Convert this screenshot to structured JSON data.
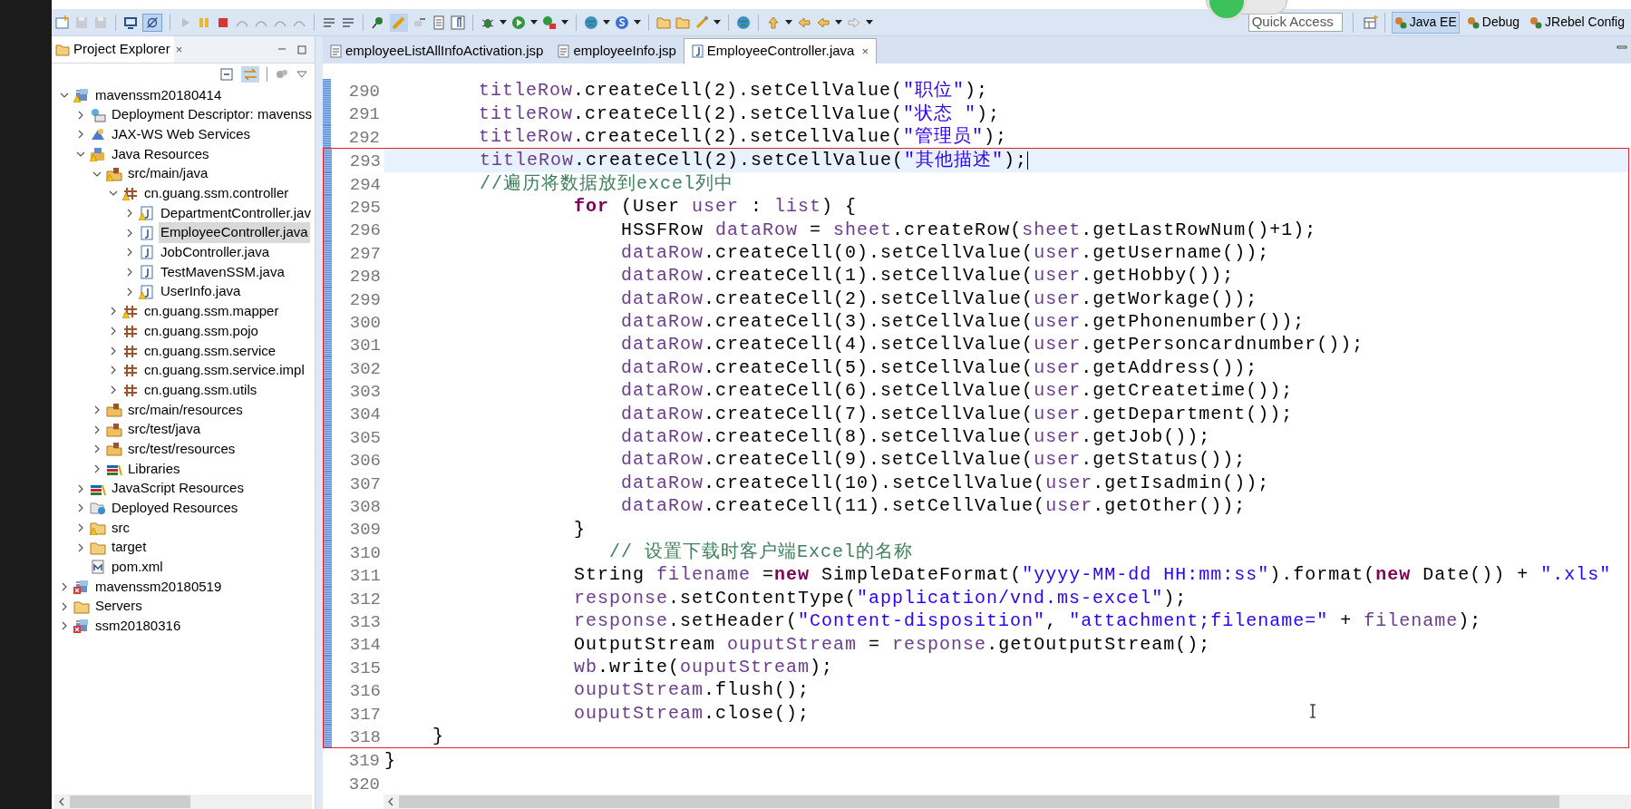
{
  "toolbar": {
    "quick_access": {
      "placeholder": "Quick Access"
    },
    "perspectives": [
      {
        "label": "Java EE",
        "selected": true
      },
      {
        "label": "Debug",
        "selected": false
      },
      {
        "label": "JRebel Config",
        "selected": false
      }
    ]
  },
  "explorer": {
    "tab": {
      "label": "Project Explorer",
      "close": "×"
    },
    "tree": [
      {
        "label": "mavenssm20180414",
        "kind": "project",
        "warning": true,
        "expanded": true,
        "selected": false,
        "children": [
          {
            "label": "Deployment Descriptor: mavenss",
            "kind": "descriptor",
            "expanded": false,
            "selected": false
          },
          {
            "label": "JAX-WS Web Services",
            "kind": "webservice",
            "expanded": false,
            "selected": false
          },
          {
            "label": "Java Resources",
            "kind": "java-resources",
            "warning": true,
            "expanded": true,
            "selected": false,
            "children": [
              {
                "label": "src/main/java",
                "kind": "source-folder",
                "warning": true,
                "expanded": true,
                "selected": false,
                "children": [
                  {
                    "label": "cn.guang.ssm.controller",
                    "kind": "package",
                    "warning": true,
                    "expanded": true,
                    "selected": false,
                    "children": [
                      {
                        "label": "DepartmentController.jav",
                        "kind": "java-file",
                        "warning": true,
                        "expanded": false,
                        "selected": false
                      },
                      {
                        "label": "EmployeeController.java",
                        "kind": "java-file",
                        "expanded": false,
                        "selected": true
                      },
                      {
                        "label": "JobController.java",
                        "kind": "java-file",
                        "expanded": false,
                        "selected": false
                      },
                      {
                        "label": "TestMavenSSM.java",
                        "kind": "java-file",
                        "expanded": false,
                        "selected": false
                      },
                      {
                        "label": "UserInfo.java",
                        "kind": "java-file",
                        "warning": true,
                        "expanded": false,
                        "selected": false
                      }
                    ]
                  },
                  {
                    "label": "cn.guang.ssm.mapper",
                    "kind": "package",
                    "warning": true,
                    "expanded": false,
                    "selected": false
                  },
                  {
                    "label": "cn.guang.ssm.pojo",
                    "kind": "package",
                    "expanded": false,
                    "selected": false
                  },
                  {
                    "label": "cn.guang.ssm.service",
                    "kind": "package",
                    "expanded": false,
                    "selected": false
                  },
                  {
                    "label": "cn.guang.ssm.service.impl",
                    "kind": "package",
                    "expanded": false,
                    "selected": false
                  },
                  {
                    "label": "cn.guang.ssm.utils",
                    "kind": "package",
                    "expanded": false,
                    "selected": false
                  }
                ]
              },
              {
                "label": "src/main/resources",
                "kind": "source-folder",
                "expanded": false,
                "selected": false
              },
              {
                "label": "src/test/java",
                "kind": "source-folder",
                "expanded": false,
                "selected": false
              },
              {
                "label": "src/test/resources",
                "kind": "source-folder",
                "expanded": false,
                "selected": false
              },
              {
                "label": "Libraries",
                "kind": "libraries",
                "expanded": false,
                "selected": false
              }
            ]
          },
          {
            "label": "JavaScript Resources",
            "kind": "libraries",
            "expanded": false,
            "selected": false
          },
          {
            "label": "Deployed Resources",
            "kind": "deployed",
            "expanded": false,
            "selected": false
          },
          {
            "label": "src",
            "kind": "folder",
            "warning": true,
            "expanded": false,
            "selected": false
          },
          {
            "label": "target",
            "kind": "folder",
            "expanded": false,
            "selected": false
          },
          {
            "label": "pom.xml",
            "kind": "xml-file",
            "selected": false
          }
        ]
      },
      {
        "label": "mavenssm20180519",
        "kind": "project",
        "error": true,
        "expanded": false,
        "selected": false
      },
      {
        "label": "Servers",
        "kind": "folder",
        "expanded": false,
        "selected": false
      },
      {
        "label": "ssm20180316",
        "kind": "project",
        "error": true,
        "expanded": false,
        "selected": false
      }
    ]
  },
  "editor": {
    "tabs": [
      {
        "label": "employeeListAllInfoActivation.jsp",
        "kind": "jsp",
        "selected": false
      },
      {
        "label": "employeeInfo.jsp",
        "kind": "jsp",
        "selected": false
      },
      {
        "label": "EmployeeController.java",
        "kind": "java",
        "selected": true,
        "close": "×"
      }
    ],
    "lines_before": [
      {
        "number": "290",
        "changed": true,
        "current": false,
        "tokens": [
          {
            "kind": "local",
            "text": "        titleRow"
          },
          {
            "kind": "plain",
            "text": ".createCell(2).setCellValue("
          },
          {
            "kind": "string",
            "text": "\"职位\""
          },
          {
            "kind": "plain",
            "text": ");"
          }
        ]
      },
      {
        "number": "291",
        "changed": true,
        "current": false,
        "tokens": [
          {
            "kind": "local",
            "text": "        titleRow"
          },
          {
            "kind": "plain",
            "text": ".createCell(2).setCellValue("
          },
          {
            "kind": "string",
            "text": "\"状态 \""
          },
          {
            "kind": "plain",
            "text": ");"
          }
        ]
      },
      {
        "number": "292",
        "changed": true,
        "current": false,
        "tokens": [
          {
            "kind": "local",
            "text": "        titleRow"
          },
          {
            "kind": "plain",
            "text": ".createCell(2).setCellValue("
          },
          {
            "kind": "string",
            "text": "\"管理员\""
          },
          {
            "kind": "plain",
            "text": ");"
          }
        ]
      }
    ],
    "lines_boxed": [
      {
        "number": "293",
        "changed": true,
        "current": true,
        "tokens": [
          {
            "kind": "local",
            "text": "        titleRow"
          },
          {
            "kind": "plain",
            "text": ".createCell(2).setCellValue("
          },
          {
            "kind": "string",
            "text": "\"其他描述\""
          },
          {
            "kind": "plain",
            "text": ");"
          }
        ]
      },
      {
        "number": "294",
        "changed": true,
        "current": false,
        "tokens": [
          {
            "kind": "comment",
            "text": "        //遍历将数据放到excel列中"
          }
        ]
      },
      {
        "number": "295",
        "changed": true,
        "current": false,
        "tokens": [
          {
            "kind": "keyword",
            "text": "                for"
          },
          {
            "kind": "plain",
            "text": " (User "
          },
          {
            "kind": "local",
            "text": "user"
          },
          {
            "kind": "plain",
            "text": " : "
          },
          {
            "kind": "local",
            "text": "list"
          },
          {
            "kind": "plain",
            "text": ") {"
          }
        ]
      },
      {
        "number": "296",
        "changed": true,
        "current": false,
        "tokens": [
          {
            "kind": "plain",
            "text": "                    HSSFRow "
          },
          {
            "kind": "local",
            "text": "dataRow"
          },
          {
            "kind": "plain",
            "text": " = "
          },
          {
            "kind": "local",
            "text": "sheet"
          },
          {
            "kind": "plain",
            "text": ".createRow("
          },
          {
            "kind": "local",
            "text": "sheet"
          },
          {
            "kind": "plain",
            "text": ".getLastRowNum()+1);"
          }
        ]
      },
      {
        "number": "297",
        "changed": true,
        "current": false,
        "tokens": [
          {
            "kind": "local",
            "text": "                    dataRow"
          },
          {
            "kind": "plain",
            "text": ".createCell(0).setCellValue("
          },
          {
            "kind": "local",
            "text": "user"
          },
          {
            "kind": "plain",
            "text": ".getUsername());"
          }
        ]
      },
      {
        "number": "298",
        "changed": true,
        "current": false,
        "tokens": [
          {
            "kind": "local",
            "text": "                    dataRow"
          },
          {
            "kind": "plain",
            "text": ".createCell(1).setCellValue("
          },
          {
            "kind": "local",
            "text": "user"
          },
          {
            "kind": "plain",
            "text": ".getHobby());"
          }
        ]
      },
      {
        "number": "299",
        "changed": true,
        "current": false,
        "tokens": [
          {
            "kind": "local",
            "text": "                    dataRow"
          },
          {
            "kind": "plain",
            "text": ".createCell(2).setCellValue("
          },
          {
            "kind": "local",
            "text": "user"
          },
          {
            "kind": "plain",
            "text": ".getWorkage());"
          }
        ]
      },
      {
        "number": "300",
        "changed": true,
        "current": false,
        "tokens": [
          {
            "kind": "local",
            "text": "                    dataRow"
          },
          {
            "kind": "plain",
            "text": ".createCell(3).setCellValue("
          },
          {
            "kind": "local",
            "text": "user"
          },
          {
            "kind": "plain",
            "text": ".getPhonenumber());"
          }
        ]
      },
      {
        "number": "301",
        "changed": true,
        "current": false,
        "tokens": [
          {
            "kind": "local",
            "text": "                    dataRow"
          },
          {
            "kind": "plain",
            "text": ".createCell(4).setCellValue("
          },
          {
            "kind": "local",
            "text": "user"
          },
          {
            "kind": "plain",
            "text": ".getPersoncardnumber());"
          }
        ]
      },
      {
        "number": "302",
        "changed": true,
        "current": false,
        "tokens": [
          {
            "kind": "local",
            "text": "                    dataRow"
          },
          {
            "kind": "plain",
            "text": ".createCell(5).setCellValue("
          },
          {
            "kind": "local",
            "text": "user"
          },
          {
            "kind": "plain",
            "text": ".getAddress());"
          }
        ]
      },
      {
        "number": "303",
        "changed": true,
        "current": false,
        "tokens": [
          {
            "kind": "local",
            "text": "                    dataRow"
          },
          {
            "kind": "plain",
            "text": ".createCell(6).setCellValue("
          },
          {
            "kind": "local",
            "text": "user"
          },
          {
            "kind": "plain",
            "text": ".getCreatetime());"
          }
        ]
      },
      {
        "number": "304",
        "changed": true,
        "current": false,
        "tokens": [
          {
            "kind": "local",
            "text": "                    dataRow"
          },
          {
            "kind": "plain",
            "text": ".createCell(7).setCellValue("
          },
          {
            "kind": "local",
            "text": "user"
          },
          {
            "kind": "plain",
            "text": ".getDepartment());"
          }
        ]
      },
      {
        "number": "305",
        "changed": true,
        "current": false,
        "tokens": [
          {
            "kind": "local",
            "text": "                    dataRow"
          },
          {
            "kind": "plain",
            "text": ".createCell(8).setCellValue("
          },
          {
            "kind": "local",
            "text": "user"
          },
          {
            "kind": "plain",
            "text": ".getJob());"
          }
        ]
      },
      {
        "number": "306",
        "changed": true,
        "current": false,
        "tokens": [
          {
            "kind": "local",
            "text": "                    dataRow"
          },
          {
            "kind": "plain",
            "text": ".createCell(9).setCellValue("
          },
          {
            "kind": "local",
            "text": "user"
          },
          {
            "kind": "plain",
            "text": ".getStatus());"
          }
        ]
      },
      {
        "number": "307",
        "changed": true,
        "current": false,
        "tokens": [
          {
            "kind": "local",
            "text": "                    dataRow"
          },
          {
            "kind": "plain",
            "text": ".createCell(10).setCellValue("
          },
          {
            "kind": "local",
            "text": "user"
          },
          {
            "kind": "plain",
            "text": ".getIsadmin());"
          }
        ]
      },
      {
        "number": "308",
        "changed": true,
        "current": false,
        "tokens": [
          {
            "kind": "local",
            "text": "                    dataRow"
          },
          {
            "kind": "plain",
            "text": ".createCell(11).setCellValue("
          },
          {
            "kind": "local",
            "text": "user"
          },
          {
            "kind": "plain",
            "text": ".getOther());"
          }
        ]
      },
      {
        "number": "309",
        "changed": true,
        "current": false,
        "tokens": [
          {
            "kind": "plain",
            "text": "                }"
          }
        ]
      },
      {
        "number": "310",
        "changed": true,
        "current": false,
        "tokens": [
          {
            "kind": "comment",
            "text": "                   // 设置下载时客户端Excel的名称"
          }
        ]
      },
      {
        "number": "311",
        "changed": true,
        "current": false,
        "tokens": [
          {
            "kind": "plain",
            "text": "                String "
          },
          {
            "kind": "local",
            "text": "filename"
          },
          {
            "kind": "plain",
            "text": " ="
          },
          {
            "kind": "keyword",
            "text": "new"
          },
          {
            "kind": "plain",
            "text": " SimpleDateFormat("
          },
          {
            "kind": "string",
            "text": "\"yyyy-MM-dd HH:mm:ss\""
          },
          {
            "kind": "plain",
            "text": ").format("
          },
          {
            "kind": "keyword",
            "text": "new"
          },
          {
            "kind": "plain",
            "text": " Date()) + "
          },
          {
            "kind": "string",
            "text": "\".xls\""
          }
        ]
      },
      {
        "number": "312",
        "changed": true,
        "current": false,
        "tokens": [
          {
            "kind": "local",
            "text": "                response"
          },
          {
            "kind": "plain",
            "text": ".setContentType("
          },
          {
            "kind": "string",
            "text": "\"application/vnd.ms-excel\""
          },
          {
            "kind": "plain",
            "text": ");"
          }
        ]
      },
      {
        "number": "313",
        "changed": true,
        "current": false,
        "tokens": [
          {
            "kind": "local",
            "text": "                response"
          },
          {
            "kind": "plain",
            "text": ".setHeader("
          },
          {
            "kind": "string",
            "text": "\"Content-disposition\""
          },
          {
            "kind": "plain",
            "text": ", "
          },
          {
            "kind": "string",
            "text": "\"attachment;filename=\""
          },
          {
            "kind": "plain",
            "text": " + "
          },
          {
            "kind": "local",
            "text": "filename"
          },
          {
            "kind": "plain",
            "text": ");"
          }
        ]
      },
      {
        "number": "314",
        "changed": true,
        "current": false,
        "tokens": [
          {
            "kind": "plain",
            "text": "                OutputStream "
          },
          {
            "kind": "local",
            "text": "ouputStream"
          },
          {
            "kind": "plain",
            "text": " = "
          },
          {
            "kind": "local",
            "text": "response"
          },
          {
            "kind": "plain",
            "text": ".getOutputStream();"
          }
        ]
      },
      {
        "number": "315",
        "changed": true,
        "current": false,
        "tokens": [
          {
            "kind": "local",
            "text": "                wb"
          },
          {
            "kind": "plain",
            "text": ".write("
          },
          {
            "kind": "local",
            "text": "ouputStream"
          },
          {
            "kind": "plain",
            "text": ");"
          }
        ]
      },
      {
        "number": "316",
        "changed": true,
        "current": false,
        "tokens": [
          {
            "kind": "local",
            "text": "                ouputStream"
          },
          {
            "kind": "plain",
            "text": ".flush();"
          }
        ]
      },
      {
        "number": "317",
        "changed": true,
        "current": false,
        "tokens": [
          {
            "kind": "local",
            "text": "                ouputStream"
          },
          {
            "kind": "plain",
            "text": ".close();"
          }
        ]
      },
      {
        "number": "318",
        "changed": true,
        "current": false,
        "tokens": [
          {
            "kind": "plain",
            "text": "    }"
          }
        ]
      }
    ],
    "lines_after": [
      {
        "number": "319",
        "changed": false,
        "current": false,
        "tokens": [
          {
            "kind": "plain",
            "text": "}"
          }
        ]
      },
      {
        "number": "320",
        "changed": false,
        "current": false
      }
    ]
  }
}
